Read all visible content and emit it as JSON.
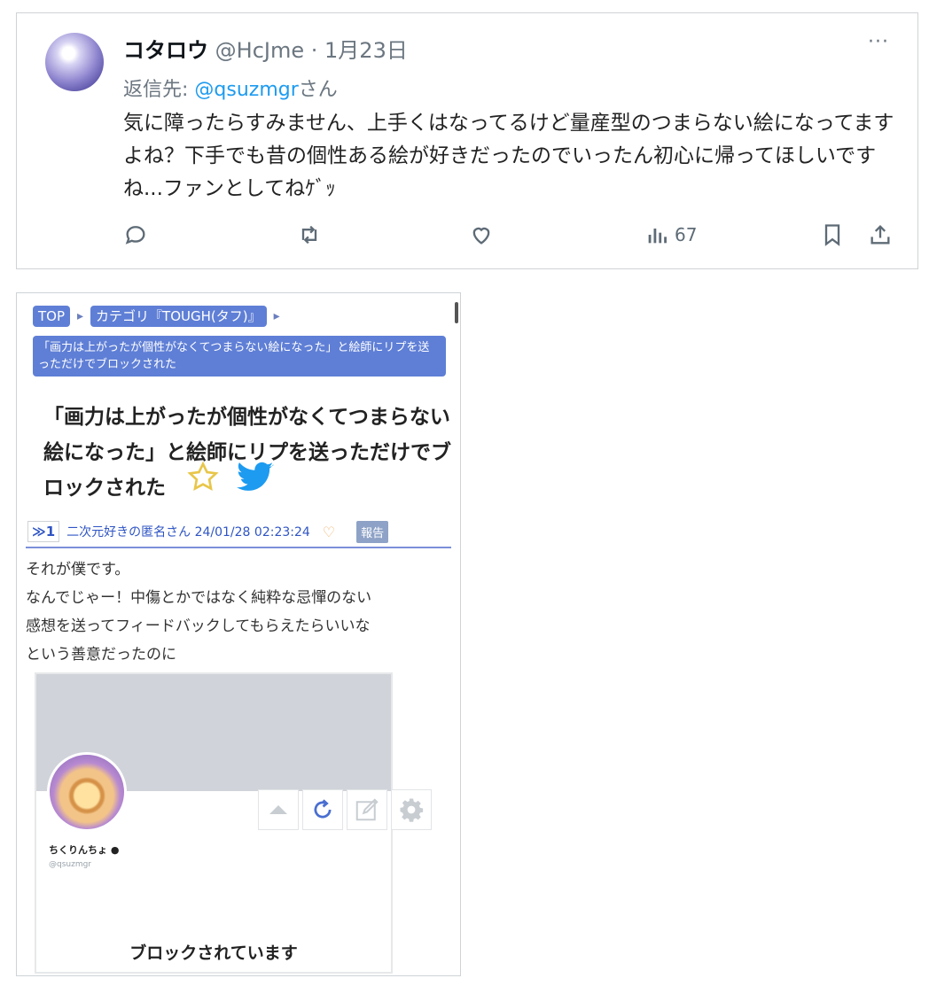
{
  "tweet": {
    "name": "コタロウ",
    "handle": "@HcJme",
    "separator": "·",
    "date": "1月23日",
    "more": "···",
    "reply_prefix": "返信先:",
    "reply_mention": "@qsuzmgr",
    "reply_suffix": "さん",
    "body": "気に障ったらすみません、上手くはなってるけど量産型のつまらない絵になってますよね？下手でも昔の個性ある絵が好きだったのでいったん初心に帰ってほしいですね...ファンとしてねｹﾞｯ",
    "views": "67"
  },
  "forum": {
    "breadcrumb": {
      "top": "TOP",
      "sep1": "▸",
      "category": "カテゴリ『TOUGH(タフ)』",
      "sep2": "▸",
      "current": "「画力は上がったが個性がなくてつまらない絵になった」と絵師にリプを送っただけでブロックされた"
    },
    "title": "「画力は上がったが個性がなくてつまらない絵になった」と絵師にリプを送っただけでブロックされた",
    "res_no": "≫1",
    "meta": "二次元好きの匿名さん 24/01/28 02:23:24",
    "report": "報告",
    "post_lines": [
      "それが僕です。",
      "なんでじゃー！中傷とかではなく純粋な忌憚のない",
      "感想を送ってフィードバックしてもらえたらいいな",
      "という善意だったのに"
    ],
    "embed": {
      "profile_name": "ちくりんちょ ●",
      "profile_handle": "@qsuzmgr",
      "blocked_text": "ブロックされています"
    }
  },
  "colors": {
    "tag_blue": "#5f7fd6",
    "link_blue": "#1d9bf0",
    "meta_blue": "#2f55c4",
    "star": "#e8c64a",
    "twitter": "#1d9bf0"
  },
  "icons": [
    "more-icon",
    "reply-icon",
    "retweet-icon",
    "like-icon",
    "views-icon",
    "bookmark-icon",
    "share-icon",
    "star-icon",
    "twitter-bird-icon",
    "heart-icon",
    "arrow-up-icon",
    "refresh-icon",
    "edit-icon",
    "gear-icon"
  ]
}
